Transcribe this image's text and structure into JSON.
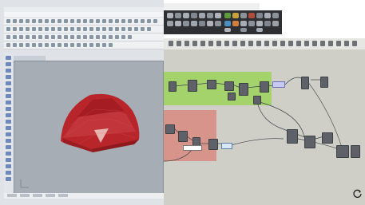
{
  "rhino": {
    "viewport_label": "",
    "axis_label": ""
  },
  "grasshopper": {
    "canvas_note": ""
  },
  "colors": {
    "brep_red": "#b8252a",
    "brep_light": "#e8b6b2",
    "group_green": "#9cd35c",
    "group_red": "#d88a80",
    "canvas": "#cfcfc8",
    "viewport": "#a6adb4"
  },
  "icons": [
    "rhino-toolbar-icons",
    "grasshopper-component-icons",
    "reload-icon"
  ]
}
